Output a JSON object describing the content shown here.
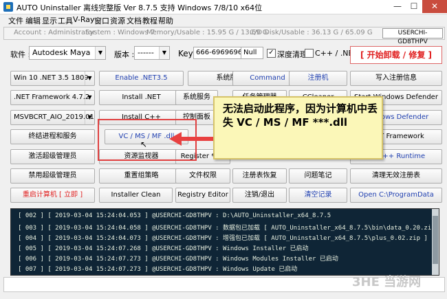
{
  "window": {
    "title": "AUTO Uninstaller 离线完整版 Ver 8.7.5 支持 Windows 7/8/10 x64位",
    "min": "—",
    "max": "☐",
    "close": "✕"
  },
  "menu": [
    "文件",
    "编辑",
    "显示",
    "工具",
    "V-Ray",
    "窗口",
    "资源",
    "文档",
    "教程",
    "帮助"
  ],
  "status": {
    "account": "Account : Administrator",
    "system": "System : Windows 7",
    "memory": "Memory/Usable : 15.95 G / 13.69 G",
    "disk": "C/D Disk/Usable : 36.13 G / 65.09 G",
    "host": "USERCHI-GD8THPV"
  },
  "software": {
    "label": "软件 :",
    "value": "Autodesk Maya",
    "version_label": "版本 :",
    "version_value": "------",
    "key_label": "Key",
    "key_value": "666-69696969",
    "key_null": "Null",
    "deep_clean_label": "深度清理",
    "deep_clean_checked": "✓",
    "cpp_label": "C++ / .NET",
    "start_button": "[ 开始卸载 / 修复 ]"
  },
  "buttons": {
    "r1": [
      ".NET 3.5 1809",
      "Enable .NET3.5",
      "系统版本",
      "Command",
      "注册机",
      "写入注册信息"
    ],
    "r1_first": "Win 10 .NET 3.5 1809",
    "r2": [
      ".NET Framework 4.7.2",
      "Install .NET",
      "系统服务",
      "任务管理器",
      "CCleaner",
      "Start Windows Defender"
    ],
    "r3": [
      "MSVBCRT_AIO_2019.01...",
      "Install C++",
      "控制面板",
      "",
      "",
      "Windows Defender"
    ],
    "r4": [
      "终结进程和服务",
      "VC / MS / MF .dll",
      "",
      "",
      "",
      ".NET Framework"
    ],
    "r5": [
      "激活超级管理员",
      "资源监视器",
      "Register *.dll",
      "",
      "",
      "All C++ Runtime"
    ],
    "r6": [
      "禁用超级管理员",
      "重置组策略",
      "文件权限",
      "注册表恢复",
      "问题笔记",
      "清理无效注册表"
    ],
    "r7": [
      "重启计算机 [ 立即 ]",
      "Installer Clean",
      "Registry Editor",
      "注销/退出",
      "清空记录",
      "Open C:\\ProgramData"
    ]
  },
  "log": [
    "[ 002 ] [ 2019-03-04 15:24:04.053 ] @USERCHI-GD8THPV : D:\\AUTO_Uninstaller_x64_8.7.5",
    "[ 003 ] [ 2019-03-04 15:24:04.058 ] @USERCHI-GD8THPV : 数据包已加载 [ AUTO_Uninstaller_x64_8.7.5\\bin\\data_0.20.zip ]",
    "[ 004 ] [ 2019-03-04 15:24:04.073 ] @USERCHI-GD8THPV : 增强包已加载 [ AUTO_Uninstaller_x64_8.7.5\\plus_0.02.zip ]",
    "[ 005 ] [ 2019-03-04 15:24:07.268 ] @USERCHI-GD8THPV : Windows Installer 已启动",
    "[ 006 ] [ 2019-03-04 15:24:07.273 ] @USERCHI-GD8THPV : Windows Modules Installer 已启动",
    "[ 007 ] [ 2019-03-04 15:24:07.273 ] @USERCHI-GD8THPV : Windows Update 已启动"
  ],
  "callout": "无法启动此程序，因为计算机中丢失 VC / MS / MF ***.dll",
  "watermark": "3HE 当游网",
  "dropdown_arrow": "▼"
}
